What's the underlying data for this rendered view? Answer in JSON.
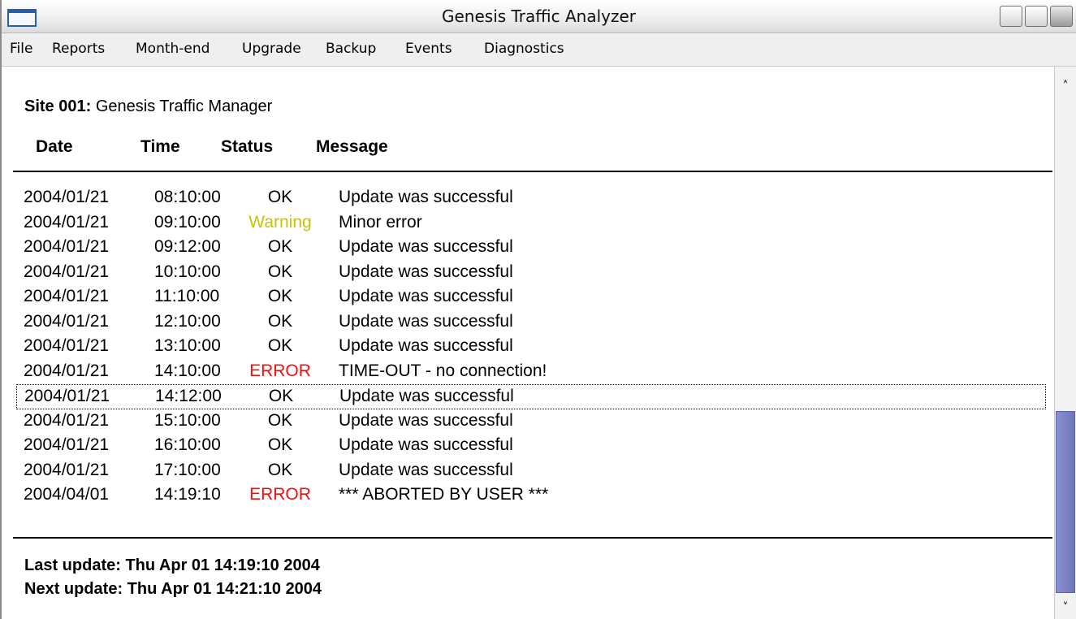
{
  "window": {
    "title": "Genesis Traffic Analyzer"
  },
  "menu": [
    "File",
    "Reports",
    "Month-end",
    "Upgrade",
    "Backup",
    "Events",
    "Diagnostics"
  ],
  "site": {
    "label": "Site 001:",
    "name": "Genesis Traffic Manager"
  },
  "columns": [
    "Date",
    "Time",
    "Status",
    "Message"
  ],
  "status_colors": {
    "OK": "#000000",
    "Warning": "#c8c400",
    "ERROR": "#ee1111"
  },
  "rows": [
    {
      "date": "2004/01/21",
      "time": "08:10:00",
      "status": "OK",
      "message": "Update was successful"
    },
    {
      "date": "2004/01/21",
      "time": "09:10:00",
      "status": "Warning",
      "message": "Minor error"
    },
    {
      "date": "2004/01/21",
      "time": "09:12:00",
      "status": "OK",
      "message": "Update was successful"
    },
    {
      "date": "2004/01/21",
      "time": "10:10:00",
      "status": "OK",
      "message": "Update was successful"
    },
    {
      "date": "2004/01/21",
      "time": "11:10:00",
      "status": "OK",
      "message": "Update was successful"
    },
    {
      "date": "2004/01/21",
      "time": "12:10:00",
      "status": "OK",
      "message": "Update was successful"
    },
    {
      "date": "2004/01/21",
      "time": "13:10:00",
      "status": "OK",
      "message": "Update was successful"
    },
    {
      "date": "2004/01/21",
      "time": "14:10:00",
      "status": "ERROR",
      "message": "TIME-OUT - no connection!"
    },
    {
      "date": "2004/01/21",
      "time": "14:12:00",
      "status": "OK",
      "message": "Update was successful",
      "focused": true
    },
    {
      "date": "2004/01/21",
      "time": "15:10:00",
      "status": "OK",
      "message": "Update was successful"
    },
    {
      "date": "2004/01/21",
      "time": "16:10:00",
      "status": "OK",
      "message": "Update was successful"
    },
    {
      "date": "2004/01/21",
      "time": "17:10:00",
      "status": "OK",
      "message": "Update was successful"
    },
    {
      "date": "2004/04/01",
      "time": "14:19:10",
      "status": "ERROR",
      "message": "*** ABORTED BY USER ***"
    }
  ],
  "footer": {
    "last_update": "Last update:  Thu Apr 01 14:19:10 2004",
    "next_update": "Next update: Thu Apr 01 14:21:10 2004"
  },
  "scrollbar": {
    "position_fraction": 0.83
  }
}
